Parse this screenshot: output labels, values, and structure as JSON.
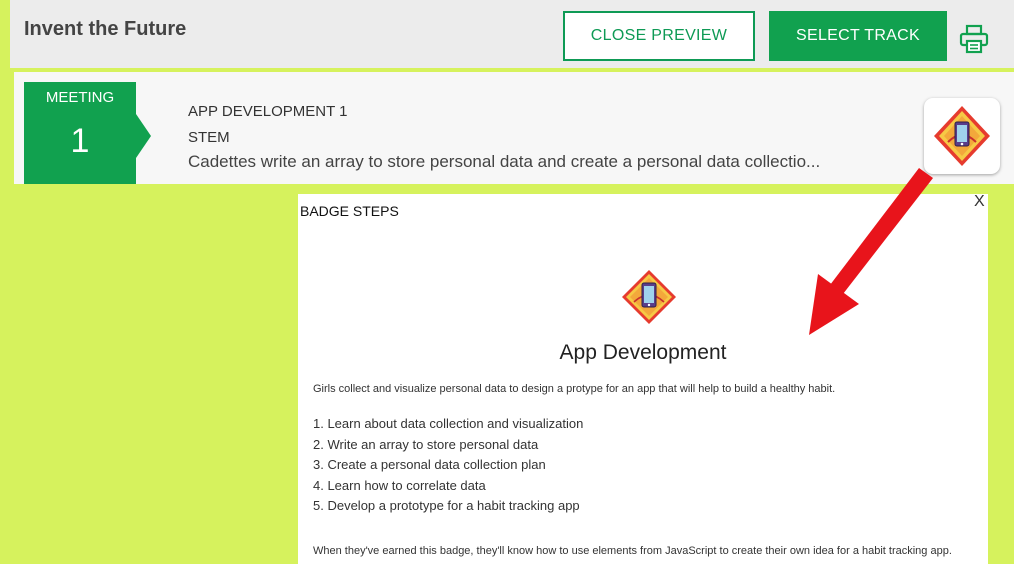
{
  "header": {
    "title": "Invent the Future",
    "close_preview_label": "CLOSE PREVIEW",
    "select_track_label": "SELECT TRACK"
  },
  "meeting": {
    "label": "MEETING",
    "number": "1",
    "name": "APP DEVELOPMENT 1",
    "category": "STEM",
    "description": "Cadettes write an array to store personal data and create a personal data collectio..."
  },
  "modal": {
    "heading": "BADGE STEPS",
    "close_label": "X",
    "badge_title": "App Development",
    "intro": "Girls collect and visualize personal data to design a protype for an app that will help to build a healthy habit.",
    "steps": [
      "1. Learn about data collection and visualization",
      "2. Write an array to store personal data",
      "3. Create a personal data collection plan",
      "4. Learn how to correlate data",
      "5. Develop a prototype for a habit tracking app"
    ],
    "footer": "When they've earned this badge, they'll know how to use elements from JavaScript to create their own idea for a habit tracking app."
  },
  "icons": {
    "print": "printer-icon",
    "badge": "app-development-badge-icon",
    "annotation": "red-arrow"
  },
  "colors": {
    "background": "#d6f25d",
    "brand_green": "#11a14f",
    "arrow_red": "#e8141b"
  }
}
